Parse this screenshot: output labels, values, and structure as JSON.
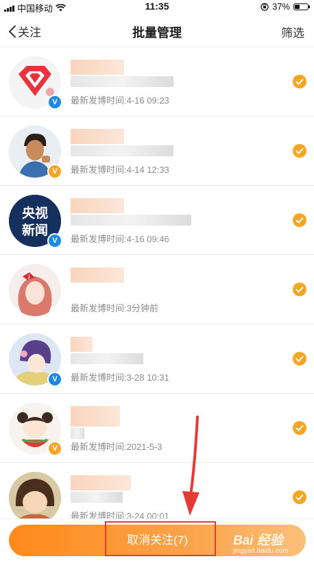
{
  "status_bar": {
    "carrier": "中国移动",
    "time": "11:35",
    "battery_pct": "37%",
    "battery_level": 0.37
  },
  "nav": {
    "back_label": "关注",
    "title": "批量管理",
    "filter_label": "筛选"
  },
  "rows": [
    {
      "meta": "最新发博时间:4-16 09:23",
      "verified_color": "#1e88e5",
      "checked": true
    },
    {
      "meta": "最新发博时间:4-14 12:33",
      "verified_color": "#f5a623",
      "checked": true
    },
    {
      "meta": "最新发博时间:4-16 09:46",
      "verified_color": "#1e88e5",
      "checked": true,
      "avatar_text": "央视新闻"
    },
    {
      "meta": "最新发博时间:3分钟前",
      "verified_color": null,
      "checked": true
    },
    {
      "meta": "最新发博时间:3-28 10:31",
      "verified_color": "#1e88e5",
      "checked": true
    },
    {
      "meta": "最新发博时间:2021-5-3",
      "verified_color": "#f5a623",
      "checked": true
    },
    {
      "meta": "最新发博时间:3-24 00:01",
      "verified_color": null,
      "checked": true
    }
  ],
  "bottom": {
    "unfollow_label": "取消关注(7)"
  },
  "watermark": {
    "brand": "Bai 经验",
    "url": "jingyan.baidu.com"
  },
  "colors": {
    "accent": "#f5a623",
    "button_start": "#ff8a1a",
    "highlight": "#e53935"
  }
}
